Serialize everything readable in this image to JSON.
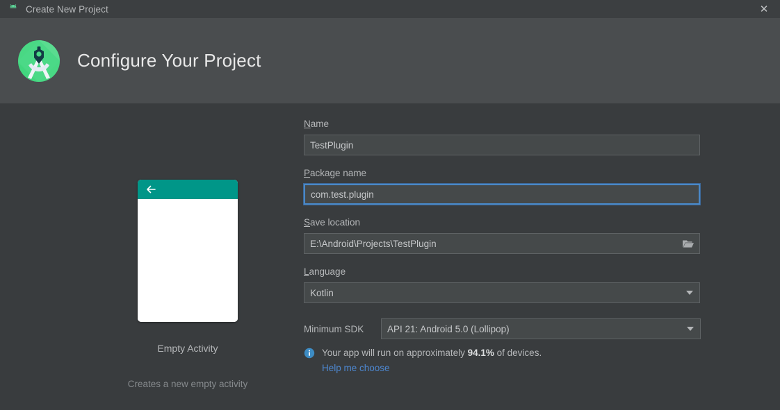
{
  "titlebar": {
    "title": "Create New Project",
    "icon": "android-robot-icon",
    "close_label": "✕"
  },
  "header": {
    "title": "Configure Your Project",
    "logo": "android-studio-logo"
  },
  "preview": {
    "title": "Empty Activity",
    "description": "Creates a new empty activity",
    "appbar_color": "#009688",
    "back_icon": "back-arrow-icon"
  },
  "form": {
    "name": {
      "label_mnemonic": "N",
      "label_rest": "ame",
      "value": "TestPlugin",
      "focused": false
    },
    "package_name": {
      "label_mnemonic": "P",
      "label_rest": "ackage name",
      "value": "com.test.plugin",
      "focused": true
    },
    "save_location": {
      "label_mnemonic": "S",
      "label_rest": "ave location",
      "value": "E:\\Android\\Projects\\TestPlugin",
      "browse_icon": "folder-open-icon"
    },
    "language": {
      "label_mnemonic": "L",
      "label_rest": "anguage",
      "value": "Kotlin"
    },
    "minimum_sdk": {
      "label": "Minimum SDK",
      "value": "API 21: Android 5.0 (Lollipop)"
    },
    "note": {
      "icon": "info-icon",
      "text_before": "Your app will run on approximately ",
      "percent": "94.1%",
      "text_after": " of devices.",
      "link": "Help me choose"
    }
  },
  "colors": {
    "accent_blue": "#4d87d0",
    "focus_border": "#4a88c7",
    "teal": "#009688",
    "android_green": "#3ddc84",
    "titlebar_bg": "#3c3f41",
    "header_bg": "#4a4d4f",
    "content_bg": "#393c3e"
  }
}
